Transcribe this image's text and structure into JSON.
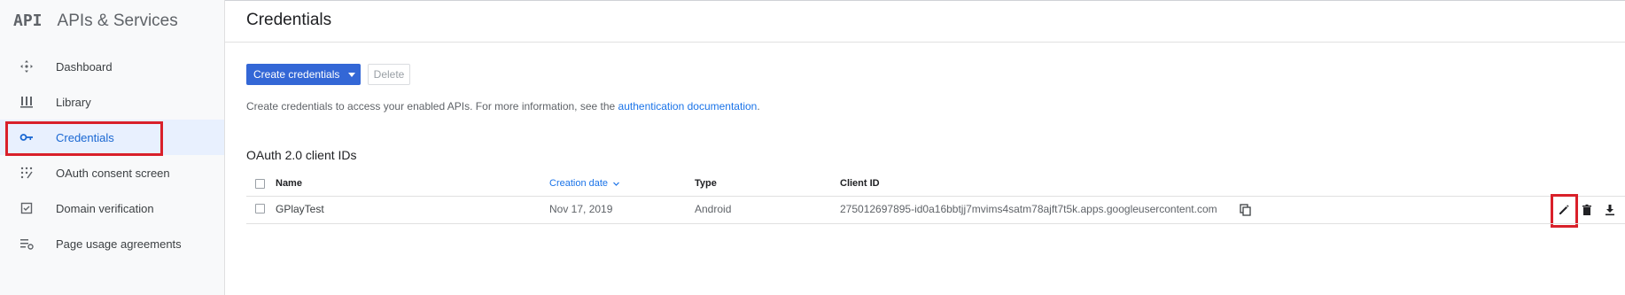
{
  "app": {
    "logo_text": "API",
    "title": "APIs & Services"
  },
  "sidebar": {
    "items": [
      {
        "label": "Dashboard",
        "icon": "dashboard-icon"
      },
      {
        "label": "Library",
        "icon": "library-icon"
      },
      {
        "label": "Credentials",
        "icon": "key-icon",
        "active": true
      },
      {
        "label": "OAuth consent screen",
        "icon": "oauth-consent-icon"
      },
      {
        "label": "Domain verification",
        "icon": "domain-verification-icon"
      },
      {
        "label": "Page usage agreements",
        "icon": "page-usage-agreements-icon"
      }
    ]
  },
  "header": {
    "title": "Credentials"
  },
  "toolbar": {
    "create_label": "Create credentials",
    "delete_label": "Delete"
  },
  "info": {
    "text": "Create credentials to access your enabled APIs. For more information, see the ",
    "link_text": "authentication documentation",
    "suffix": "."
  },
  "oauth_section": {
    "title": "OAuth 2.0 client IDs",
    "columns": {
      "name": "Name",
      "creation_date": "Creation date",
      "type": "Type",
      "client_id": "Client ID"
    },
    "rows": [
      {
        "name": "GPlayTest",
        "creation_date": "Nov 17, 2019",
        "type": "Android",
        "client_id": "275012697895-id0a16bbtjj7mvims4satm78ajft7t5k.apps.googleusercontent.com"
      }
    ]
  },
  "colors": {
    "accent": "#3367d6",
    "link": "#1a73e8",
    "active_bg": "#e8f0fe",
    "highlight": "#d9202a"
  }
}
